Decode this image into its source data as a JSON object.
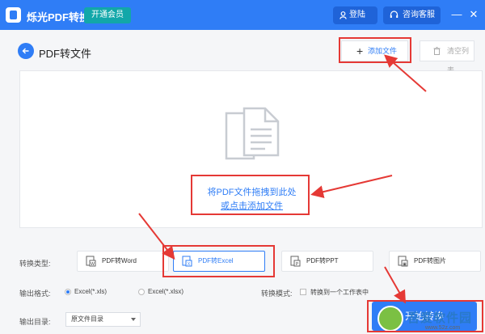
{
  "app": {
    "title": "烁光PDF转换器",
    "vip_label": "开通会员",
    "login_label": "登陆",
    "support_label": "咨询客服",
    "window_controls": [
      "—",
      "✕"
    ]
  },
  "header": {
    "page_title": "PDF转文件",
    "add_file_label": "添加文件",
    "clear_list_label": "清空列表"
  },
  "dropzone": {
    "line1": "将PDF文件拖拽到此处",
    "line2": "或点击添加文件"
  },
  "conversion": {
    "label": "转换类型:",
    "options": [
      {
        "label": "PDF转Word",
        "icon_letter": "W",
        "active": false
      },
      {
        "label": "PDF转Excel",
        "icon_letter": "X",
        "active": true
      },
      {
        "label": "PDF转PPT",
        "icon_letter": "P",
        "active": false
      },
      {
        "label": "PDF转图片",
        "icon_letter": "▣",
        "active": false
      }
    ]
  },
  "output_format": {
    "label": "输出格式:",
    "options": [
      {
        "label": "Excel(*.xls)",
        "checked": true
      },
      {
        "label": "Excel(*.xlsx)",
        "checked": false
      }
    ],
    "mode_label": "转换模式:",
    "mode_checkbox_label": "转换到一个工作表中"
  },
  "output_dir": {
    "label": "输出目录:",
    "value": "原文件目录"
  },
  "start_button": {
    "label": "开始转换"
  },
  "watermark": {
    "text": "吾爱软件园",
    "url": "www.52z.com"
  },
  "colors": {
    "primary": "#2f7df6",
    "vip": "#12a7a9",
    "annotation": "#e53935"
  }
}
